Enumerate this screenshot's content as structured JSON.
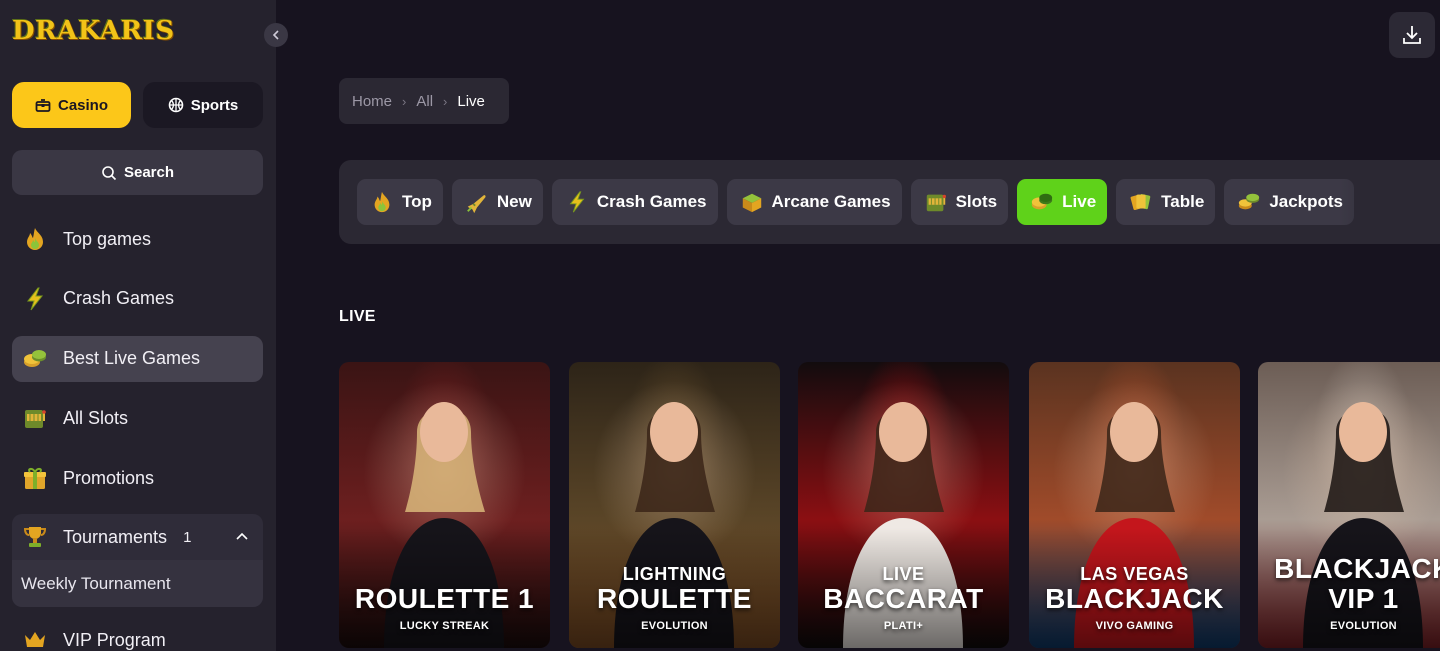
{
  "brand": {
    "logo_text": "DRAKARIS"
  },
  "sidebar": {
    "casino_label": "Casino",
    "sports_label": "Sports",
    "search_label": "Search",
    "items": [
      {
        "label": "Top games",
        "icon": "fire-icon",
        "active": false
      },
      {
        "label": "Crash Games",
        "icon": "lightning-icon",
        "active": false
      },
      {
        "label": "Best Live Games",
        "icon": "chips-icon",
        "active": true
      },
      {
        "label": "All Slots",
        "icon": "slot-machine-icon",
        "active": false
      },
      {
        "label": "Promotions",
        "icon": "gift-icon",
        "active": false
      }
    ],
    "tournaments": {
      "label": "Tournaments",
      "count": "1",
      "sub_label": "Weekly Tournament"
    },
    "vip_label": "VIP Program"
  },
  "breadcrumb": {
    "home": "Home",
    "all": "All",
    "current": "Live"
  },
  "categories": [
    {
      "label": "Top",
      "icon": "fire-icon"
    },
    {
      "label": "New",
      "icon": "rocket-icon"
    },
    {
      "label": "Crash Games",
      "icon": "lightning-icon"
    },
    {
      "label": "Arcane Games",
      "icon": "treasure-box-icon"
    },
    {
      "label": "Slots",
      "icon": "slot-machine-icon"
    },
    {
      "label": "Live",
      "icon": "chips-icon",
      "active": true
    },
    {
      "label": "Table",
      "icon": "cards-icon"
    },
    {
      "label": "Jackpots",
      "icon": "coins-icon"
    }
  ],
  "section": {
    "title": "LIVE"
  },
  "games": [
    {
      "line1": "",
      "line2": "ROULETTE 1",
      "provider": "LUCKY STREAK",
      "colors": [
        "#3a1414",
        "#6d1f1f",
        "#1a0b0b"
      ]
    },
    {
      "line1": "LIGHTNING",
      "line2": "ROULETTE",
      "provider": "EVOLUTION",
      "colors": [
        "#2d2418",
        "#5a4527",
        "#7a4a22"
      ]
    },
    {
      "line1": "LIVE",
      "line2": "BACCARAT",
      "provider": "PLATI+",
      "colors": [
        "#120c0e",
        "#8b0f12",
        "#0e0a0b"
      ]
    },
    {
      "line1": "LAS VEGAS",
      "line2": "BLACKJACK",
      "provider": "VIVO GAMING",
      "colors": [
        "#5a3320",
        "#a04b2a",
        "#0d3a6b"
      ]
    },
    {
      "line1": "BLACKJACK",
      "line2": "VIP 1",
      "provider": "EVOLUTION",
      "colors": [
        "#6c5d55",
        "#a99c93",
        "#7a1f24"
      ]
    }
  ]
}
